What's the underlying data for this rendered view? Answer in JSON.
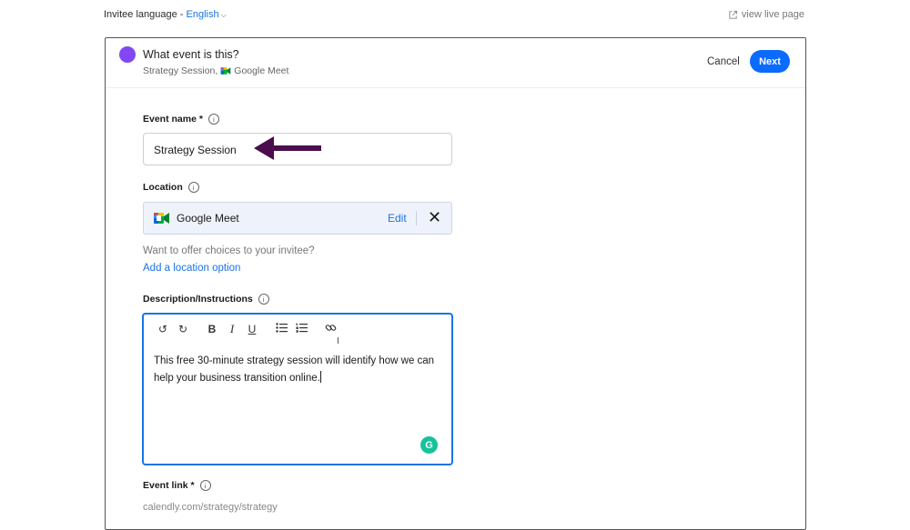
{
  "topbar": {
    "language_label": "Invitee language - ",
    "language_value": "English",
    "view_live_label": "view live page"
  },
  "header": {
    "title": "What event is this?",
    "subtitle_event": "Strategy Session,",
    "subtitle_location": "Google Meet",
    "cancel_label": "Cancel",
    "next_label": "Next",
    "dot_color": "#8247f5"
  },
  "event_name": {
    "label": "Event name *",
    "value": "Strategy Session",
    "annotation_arrow_color": "#4a0d4d"
  },
  "location": {
    "label": "Location",
    "name": "Google Meet",
    "edit_label": "Edit",
    "icon": "google-meet-icon",
    "offer_text": "Want to offer choices to your invitee?",
    "add_option_label": "Add a location option"
  },
  "description": {
    "label": "Description/Instructions",
    "text": "This free 30-minute strategy session will identify how we can help your business transition online.",
    "toolbar": [
      "undo-icon",
      "redo-icon",
      "bold-icon",
      "italic-icon",
      "underline-icon",
      "bullet-list-icon",
      "numbered-list-icon",
      "link-icon"
    ],
    "grammarly_label": "G"
  },
  "event_link": {
    "label": "Event link *",
    "value": "calendly.com/strategy/strategy"
  },
  "colors": {
    "accent": "#0b6bff",
    "link": "#1a73e8",
    "grammarly": "#15c39a"
  }
}
